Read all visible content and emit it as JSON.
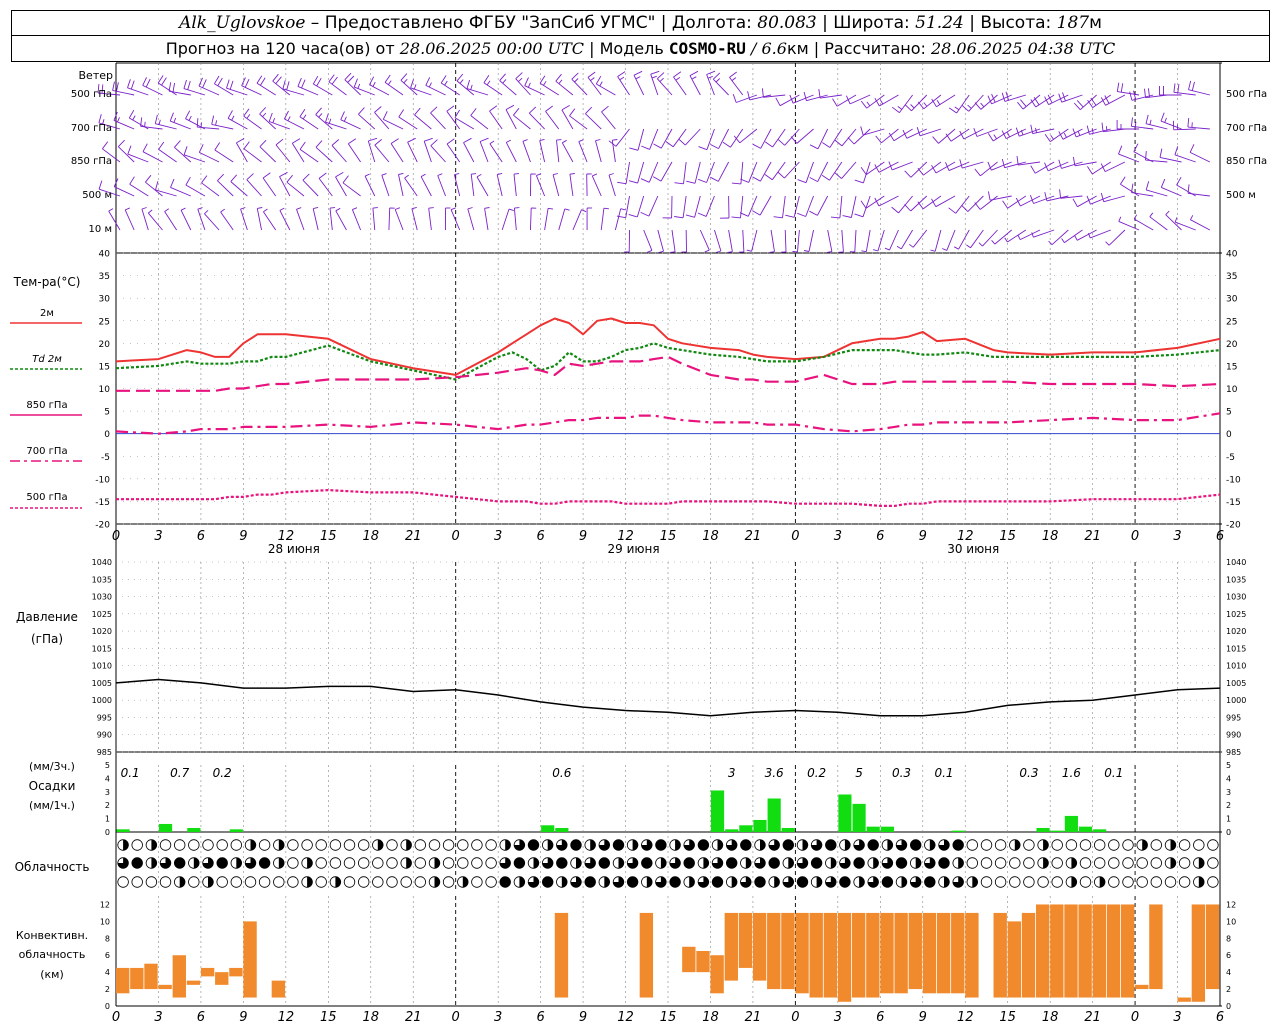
{
  "header": {
    "station": "Alk_Uglovskoe",
    "provider": " – Предоставлено ФГБУ \"ЗапСиб УГМС\" | ",
    "lon_label": "Долгота: ",
    "lon_value": "80.083",
    "lat_label": " | Широта: ",
    "lat_value": "51.24",
    "alt_label": " | Высота: ",
    "alt_value": "187",
    "alt_unit": "м",
    "forecast_label": "Прогноз на 120 часа(ов) от ",
    "forecast_from": "28.06.2025 00:00 UTC",
    "model_label": "  | Модель ",
    "model_name": "COSMO-RU",
    "model_res": " / 6.6",
    "model_res_unit": "км",
    "calc_label": " | Рассчитано: ",
    "calc_time": "28.06.2025 04:38 UTC"
  },
  "axis": {
    "hour_labels": [
      "0",
      "3",
      "6",
      "9",
      "12",
      "15",
      "18",
      "21",
      "0",
      "3",
      "6",
      "9",
      "12",
      "15",
      "18",
      "21",
      "0",
      "3",
      "6",
      "9",
      "12",
      "15",
      "18",
      "21",
      "0",
      "3",
      "6"
    ],
    "day_labels": [
      "28 июня",
      "29 июня",
      "30 июня"
    ]
  },
  "wind_panel": {
    "title": "Ветер",
    "levels": [
      "500 гПа",
      "700 гПа",
      "850 гПа",
      "500 м",
      "10  м"
    ]
  },
  "temp_panel": {
    "title": "Тем-ра(°C)",
    "legend": [
      {
        "label": "2м",
        "color": "#ee3333"
      },
      {
        "label": "Td  2м",
        "color": "#118811"
      },
      {
        "label": "850 гПа",
        "color": "#e8137e"
      },
      {
        "label": "700 гПа",
        "color": "#e8137e"
      },
      {
        "label": "500 гПа",
        "color": "#e8137e"
      }
    ],
    "ticks": [
      "40",
      "35",
      "30",
      "25",
      "20",
      "15",
      "10",
      "5",
      "0",
      "-5",
      "-10",
      "-15",
      "-20"
    ]
  },
  "pressure_panel": {
    "title": "Давление",
    "unit": "(гПа)",
    "ticks": [
      "1040",
      "1035",
      "1030",
      "1025",
      "1020",
      "1015",
      "1010",
      "1005",
      "1000",
      "995",
      "990",
      "985"
    ]
  },
  "precip_panel": {
    "unit_top": "(мм/3ч.)",
    "title": "Осадки",
    "unit_bottom": "(мм/1ч.)",
    "ticks": [
      "5",
      "4",
      "3",
      "2",
      "1",
      "0"
    ],
    "labels": [
      {
        "h": 1,
        "text": "0.1"
      },
      {
        "h": 4.5,
        "text": "0.7"
      },
      {
        "h": 7.5,
        "text": "0.2"
      },
      {
        "h": 31.5,
        "text": "0.6"
      },
      {
        "h": 43.5,
        "text": "3"
      },
      {
        "h": 46.5,
        "text": "3.6"
      },
      {
        "h": 49.5,
        "text": "0.2"
      },
      {
        "h": 52.5,
        "text": "5"
      },
      {
        "h": 55.5,
        "text": "0.3"
      },
      {
        "h": 58.5,
        "text": "0.1"
      },
      {
        "h": 64.5,
        "text": "0.3"
      },
      {
        "h": 67.5,
        "text": "1.6"
      },
      {
        "h": 70.5,
        "text": "0.1"
      }
    ]
  },
  "cloud_panel": {
    "title": "Облачность"
  },
  "conv_panel": {
    "title_1": "Конвективн.",
    "title_2": "облачность",
    "title_3": "(км)",
    "ticks": [
      "12",
      "10",
      "8",
      "6",
      "4",
      "2",
      "0"
    ]
  },
  "colors": {
    "temp2m": "#ee3333",
    "td": "#118811",
    "upper": "#e8137e",
    "wind": "#7a1fc9",
    "precip": "#11dd11",
    "conv": "#f08a2c",
    "zero": "#3344cc",
    "grid": "#888888"
  },
  "chart_data": [
    {
      "type": "line",
      "title": "Тем-ра(°C)",
      "x_hours": [
        0,
        3,
        5,
        6,
        7,
        8,
        9,
        10,
        11,
        12,
        15,
        18,
        21,
        24,
        27,
        28,
        29,
        30,
        31,
        32,
        33,
        34,
        35,
        36,
        37,
        38,
        39,
        40,
        42,
        44,
        45,
        46,
        48,
        50,
        52,
        54,
        55,
        56,
        57,
        58,
        60,
        62,
        63,
        66,
        69,
        72,
        75,
        78
      ],
      "series": [
        {
          "name": "2м",
          "values": [
            16,
            16.5,
            18.5,
            18,
            17,
            17,
            20,
            22,
            22,
            22,
            21,
            16.5,
            14.5,
            13,
            18,
            20,
            22,
            24,
            25.5,
            24.5,
            22,
            25,
            25.5,
            24.5,
            24.5,
            24,
            21,
            20,
            19,
            18.5,
            17.5,
            17,
            16.5,
            17,
            20,
            21,
            21,
            21.5,
            22.5,
            20.5,
            21,
            18.5,
            18,
            17.5,
            18,
            18,
            19,
            21
          ]
        },
        {
          "name": "Td  2м",
          "values": [
            14.5,
            15,
            16,
            15.5,
            15.5,
            15.5,
            16,
            16,
            17,
            17,
            19.5,
            16,
            14,
            12,
            17,
            18,
            16.5,
            14,
            15,
            18,
            16,
            16,
            17,
            18.5,
            19,
            20,
            19,
            18.5,
            17.5,
            17,
            16.5,
            16,
            16,
            17,
            18.5,
            18.5,
            18.5,
            18,
            17.5,
            17.5,
            18,
            17,
            17,
            17,
            17,
            17,
            17.5,
            18.5
          ]
        },
        {
          "name": "850 гПа",
          "values": [
            9.5,
            9.5,
            9.5,
            9.5,
            9.5,
            10,
            10,
            10.5,
            11,
            11,
            12,
            12,
            12,
            12.5,
            13.5,
            14,
            14.5,
            14,
            13,
            15.5,
            15,
            15.5,
            16,
            16,
            16,
            16.5,
            17,
            15.5,
            13,
            12,
            12,
            11.5,
            11.5,
            13,
            11,
            11,
            11.5,
            11.5,
            11.5,
            11.5,
            11.5,
            11.5,
            11.5,
            11,
            11,
            11,
            10.5,
            11
          ]
        },
        {
          "name": "700 гПа",
          "values": [
            0.5,
            0,
            0.5,
            1,
            1,
            1,
            1.5,
            1.5,
            1.5,
            1.5,
            2,
            1.5,
            2.5,
            2,
            1,
            1.5,
            2,
            2,
            2.5,
            3,
            3,
            3.5,
            3.5,
            3.5,
            4,
            4,
            3.5,
            3,
            2.5,
            2.5,
            2.5,
            2,
            2,
            1,
            0.5,
            1,
            1.5,
            2,
            2,
            2.5,
            2.5,
            2.5,
            2.5,
            3,
            3.5,
            3,
            3,
            4.5
          ]
        },
        {
          "name": "500 гПа",
          "values": [
            -14.5,
            -14.5,
            -14.5,
            -14.5,
            -14.5,
            -14,
            -14,
            -13.5,
            -13.5,
            -13,
            -12.5,
            -13,
            -13,
            -14,
            -15,
            -15,
            -15,
            -15.5,
            -15.5,
            -15,
            -15,
            -15,
            -15,
            -15.5,
            -15.5,
            -15.5,
            -15.5,
            -15,
            -15,
            -15,
            -15,
            -15,
            -15.5,
            -15.5,
            -15.5,
            -16,
            -16,
            -15.5,
            -15.5,
            -15,
            -15,
            -15,
            -15,
            -15,
            -14.5,
            -14.5,
            -14.5,
            -13.5
          ]
        }
      ],
      "ylim": [
        -20,
        40
      ]
    },
    {
      "type": "line",
      "title": "Давление",
      "ylabel": "(гПа)",
      "x_hours": [
        0,
        3,
        6,
        9,
        12,
        15,
        18,
        21,
        24,
        27,
        30,
        33,
        36,
        39,
        42,
        45,
        48,
        51,
        54,
        57,
        60,
        63,
        66,
        69,
        72,
        75,
        78
      ],
      "series": [
        {
          "name": "Давление",
          "values": [
            1005,
            1006,
            1005,
            1003.5,
            1003.5,
            1004,
            1004,
            1002.5,
            1003,
            1001.5,
            999.5,
            998,
            997,
            996.5,
            995.5,
            996.5,
            997,
            996.5,
            995.5,
            995.5,
            996.5,
            998.5,
            999.5,
            1000,
            1001.5,
            1003,
            1003.5
          ]
        }
      ],
      "ylim": [
        985,
        1040
      ]
    },
    {
      "type": "bar",
      "title": "Осадки",
      "ylabel": "(мм/1ч.)",
      "x_hours": [
        0,
        3,
        5,
        8,
        30,
        31,
        42,
        43,
        44,
        45,
        46,
        47,
        48,
        51,
        52,
        53,
        54,
        59,
        65,
        66,
        67,
        68,
        69
      ],
      "values": [
        0.2,
        0.6,
        0.3,
        0.2,
        0.5,
        0.3,
        3.1,
        0.2,
        0.5,
        0.9,
        2.5,
        0.3,
        0,
        2.8,
        2.1,
        0.4,
        0.4,
        0.1,
        0.3,
        0.1,
        1.2,
        0.4,
        0.2
      ],
      "ylim": [
        0,
        5
      ]
    },
    {
      "type": "bar",
      "title": "Конвективн. облачность (км)",
      "x_hours": [
        0,
        1,
        2,
        3,
        4,
        5,
        6,
        7,
        8,
        9,
        11,
        31,
        37,
        40,
        41,
        42,
        43,
        44,
        45,
        46,
        47,
        48,
        49,
        50,
        51,
        52,
        53,
        54,
        55,
        56,
        57,
        58,
        59,
        60,
        62,
        63,
        64,
        65,
        66,
        67,
        68,
        69,
        70,
        71,
        72,
        73,
        75,
        76,
        77
      ],
      "bottoms": [
        1.5,
        2,
        2,
        2,
        1,
        2.5,
        3.5,
        2.5,
        3.5,
        1,
        1,
        1,
        1,
        4,
        4,
        1.5,
        3,
        4.5,
        3,
        2,
        2,
        1.5,
        1,
        1,
        0.5,
        1,
        1,
        1.5,
        1.5,
        2,
        1.5,
        1.5,
        1.5,
        1,
        1,
        1,
        1,
        1,
        1,
        1,
        1,
        1,
        1,
        1,
        2,
        2,
        0.5,
        0.5,
        2
      ],
      "tops": [
        4.5,
        4.5,
        5,
        2.5,
        6,
        3,
        4.5,
        4,
        4.5,
        10,
        3,
        11,
        11,
        7,
        6.5,
        6,
        11,
        11,
        11,
        11,
        11,
        11,
        11,
        11,
        11,
        11,
        11,
        11,
        11,
        11,
        11,
        11,
        11,
        11,
        11,
        10,
        11,
        12,
        12,
        12,
        12,
        12,
        12,
        12,
        2.5,
        12,
        1,
        12,
        12
      ],
      "ylim": [
        0,
        13
      ]
    }
  ]
}
